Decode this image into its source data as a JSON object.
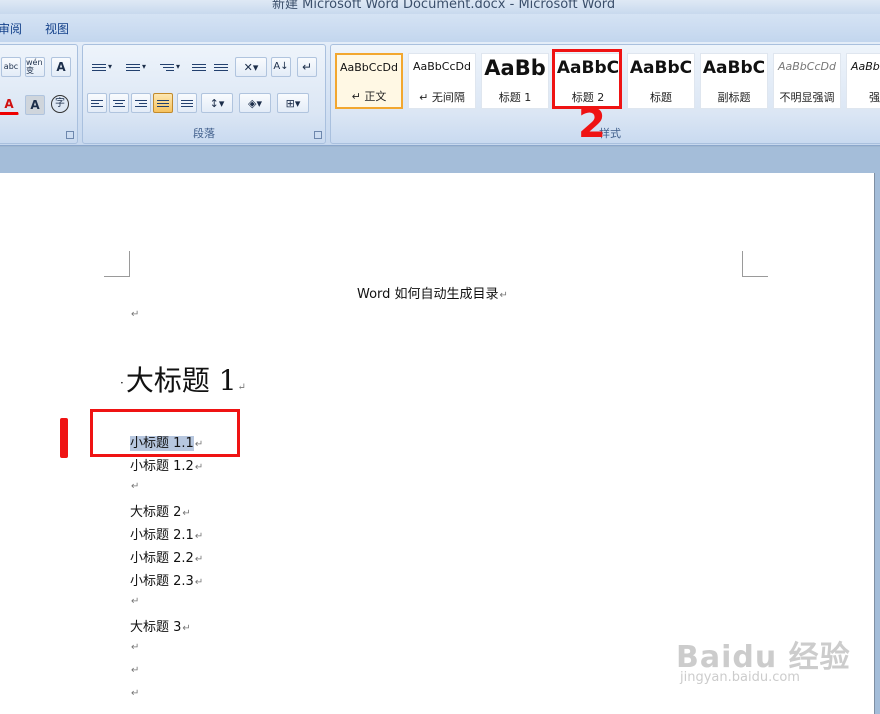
{
  "window": {
    "title": "新建 Microsoft Word Document.docx - Microsoft Word"
  },
  "tabs": {
    "review": "审阅",
    "view": "视图"
  },
  "ribbon": {
    "paragraph_group_label": "段落",
    "styles_group_label": "样式",
    "font_row1": [
      "abc",
      "wén 变",
      "A"
    ],
    "font_row2": [
      "A",
      "A",
      "字"
    ]
  },
  "styles": [
    {
      "sample": "AaBbCcDd",
      "name": "↵ 正文"
    },
    {
      "sample": "AaBbCcDd",
      "name": "↵ 无间隔"
    },
    {
      "sample": "AaBb",
      "name": "标题 1"
    },
    {
      "sample": "AaBbC",
      "name": "标题 2"
    },
    {
      "sample": "AaBbC",
      "name": "标题"
    },
    {
      "sample": "AaBbC",
      "name": "副标题"
    },
    {
      "sample": "AaBbCcDd",
      "name": "不明显强调"
    },
    {
      "sample": "AaBbCcDd",
      "name": "强调"
    }
  ],
  "document": {
    "title": "Word 如何自动生成目录",
    "heading1": "大标题 1",
    "lines": [
      "小标题 1.1",
      "小标题 1.2",
      "",
      "大标题 2",
      "小标题 2.1",
      "小标题 2.2",
      "小标题 2.3",
      "",
      "大标题 3",
      "",
      "",
      ""
    ],
    "paragraph_mark": "↵"
  },
  "annotations": {
    "step1": "1",
    "step2": "2"
  },
  "watermark": {
    "brand": "Baidu 经验",
    "url": "jingyan.baidu.com"
  },
  "colors": {
    "annotation_red": "#ef1313",
    "selection_highlight": "#b7c7df",
    "selected_style_border": "#f2a72f"
  }
}
